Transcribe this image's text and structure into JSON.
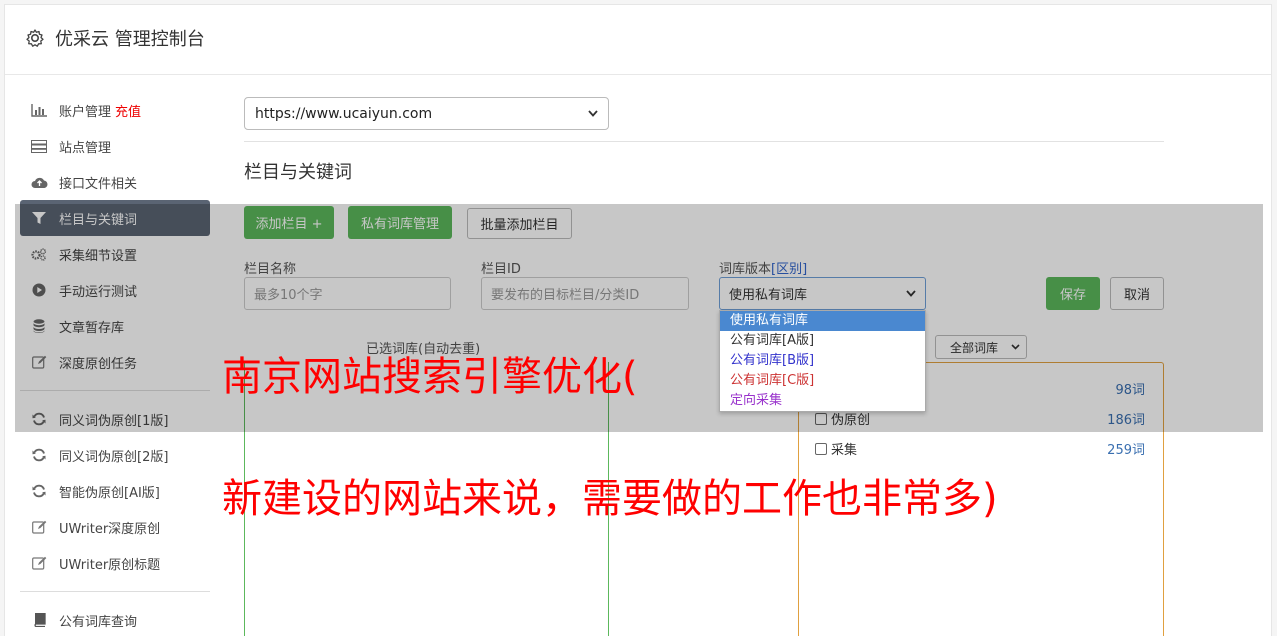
{
  "header": {
    "title": "优采云 管理控制台"
  },
  "sidebar": {
    "items": [
      {
        "label": "账户管理",
        "icon": "bar-chart-icon",
        "extra": "充值"
      },
      {
        "label": "站点管理",
        "icon": "server-icon"
      },
      {
        "label": "接口文件相关",
        "icon": "cloud-upload-icon"
      },
      {
        "label": "栏目与关键词",
        "icon": "filter-icon",
        "active": true
      },
      {
        "label": "采集细节设置",
        "icon": "gears-icon"
      },
      {
        "label": "手动运行测试",
        "icon": "play-circle-icon"
      },
      {
        "label": "文章暂存库",
        "icon": "database-icon"
      },
      {
        "label": "深度原创任务",
        "icon": "edit-icon"
      }
    ],
    "items2": [
      {
        "label": "同义词伪原创[1版]",
        "icon": "refresh-icon"
      },
      {
        "label": "同义词伪原创[2版]",
        "icon": "refresh-icon"
      },
      {
        "label": "智能伪原创[AI版]",
        "icon": "refresh-icon"
      },
      {
        "label": "UWriter深度原创",
        "icon": "edit-icon"
      },
      {
        "label": "UWriter原创标题",
        "icon": "edit-icon"
      }
    ],
    "items3": [
      {
        "label": "公有词库查询",
        "icon": "book-icon"
      }
    ]
  },
  "site_select": {
    "value": "https://www.ucaiyun.com"
  },
  "section": {
    "title": "栏目与关键词"
  },
  "toolbar": {
    "add_column": "添加栏目 +",
    "private_lib": "私有词库管理",
    "batch_add": "批量添加栏目"
  },
  "form": {
    "name_label": "栏目名称",
    "name_placeholder": "最多10个字",
    "id_label": "栏目ID",
    "id_placeholder": "要发布的目标栏目/分类ID",
    "lib_label": "词库版本",
    "lib_diff": "[区别]",
    "lib_value": "使用私有词库",
    "save": "保存",
    "cancel": "取消"
  },
  "dropdown": {
    "options": [
      {
        "label": "使用私有词库",
        "color": "#ffffff",
        "selected": true
      },
      {
        "label": "公有词库[A版]",
        "color": "#333333"
      },
      {
        "label": "公有词库[B版]",
        "color": "#3333cc"
      },
      {
        "label": "公有词库[C版]",
        "color": "#cc3333"
      },
      {
        "label": "定向采集",
        "color": "#9933cc"
      }
    ]
  },
  "selected_words": {
    "label": "已选词库(自动去重)"
  },
  "lib_filter": {
    "value": "全部词库"
  },
  "categories": [
    {
      "label": "",
      "count": "98词"
    },
    {
      "label": "伪原创",
      "count": "186词"
    },
    {
      "label": "采集",
      "count": "259词"
    }
  ],
  "watermark": {
    "line1": "南京网站搜索引擎优化(",
    "line2": "新建设的网站来说，需要做的工作也非常多)",
    "color": "#ff0000"
  }
}
